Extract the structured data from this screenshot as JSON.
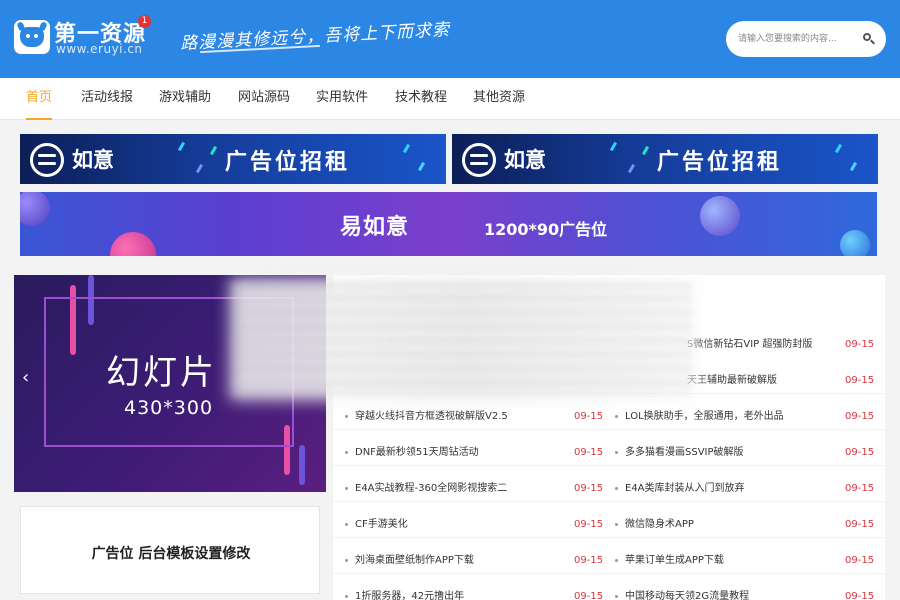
{
  "header": {
    "site_name": "第一资源",
    "site_url": "www.eruyi.cn",
    "badge": "1",
    "slogan": "路漫漫其修远兮，吾将上下而求索",
    "search_placeholder": "请输入您要搜索的内容..."
  },
  "nav": {
    "items": [
      "首页",
      "活动线报",
      "游戏辅助",
      "网站源码",
      "实用软件",
      "技术教程",
      "其他资源"
    ],
    "active_index": 0
  },
  "ads": {
    "top_left_brand": "如意",
    "top_left_slogan": "广告位招租",
    "top_right_brand": "如意",
    "top_right_slogan": "广告位招租",
    "wide_brand": "易如意",
    "wide_size": "1200*90广告位",
    "side_text": "广告位 后台模板设置修改"
  },
  "slider": {
    "title": "幻灯片",
    "size": "430*300",
    "prev_arrow": "‹"
  },
  "list": {
    "right_column": [
      {
        "title": "S微信新钻石VIP 超强防封版",
        "date": "09-15"
      },
      {
        "title": "天王辅助最新破解版",
        "date": "09-15"
      },
      {
        "title": "LOL换肤助手，全服通用，老外出品",
        "date": "09-15"
      },
      {
        "title": "多多猫看漫画SSVIP破解版",
        "date": "09-15"
      },
      {
        "title": "E4A类库封装从入门到放弃",
        "date": "09-15"
      },
      {
        "title": "微信隐身术APP",
        "date": "09-15"
      },
      {
        "title": "苹果订单生成APP下载",
        "date": "09-15"
      },
      {
        "title": "中国移动每天领2G流量教程",
        "date": "09-15"
      }
    ],
    "left_column": [
      {
        "title": "穿越火线抖音方框透视破解版V2.5",
        "date": "09-15"
      },
      {
        "title": "DNF最新秒领51天周钻活动",
        "date": "09-15"
      },
      {
        "title": "E4A实战教程-360全网影视搜索二",
        "date": "09-15"
      },
      {
        "title": "CF手游美化",
        "date": "09-15"
      },
      {
        "title": "刘海桌面壁纸制作APP下载",
        "date": "09-15"
      },
      {
        "title": "1折服务器，42元撸出年",
        "date": "09-15"
      }
    ]
  },
  "colors": {
    "header_bg": "#2b86e4",
    "nav_active": "#f5a623",
    "date_red": "#d9363e"
  },
  "icons": {
    "logo": "cow-logo-icon",
    "search": "search-icon",
    "slider_prev": "chevron-left-icon",
    "ad_logo": "ruyi-logo-icon"
  }
}
